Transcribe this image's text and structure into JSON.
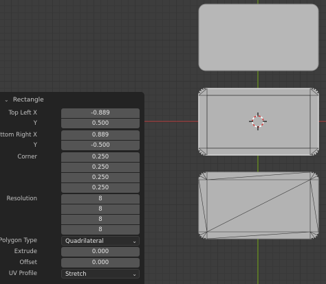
{
  "panel": {
    "title": "Rectangle",
    "top_left_x_label": "Top Left X",
    "top_left_x": "-0.889",
    "top_left_y_label": "Y",
    "top_left_y": "0.500",
    "bottom_right_x_label": "Bottom Right X",
    "bottom_right_x": "0.889",
    "bottom_right_y_label": "Y",
    "bottom_right_y": "-0.500",
    "corner_label": "Corner",
    "corner": [
      "0.250",
      "0.250",
      "0.250",
      "0.250"
    ],
    "resolution_label": "Resolution",
    "resolution": [
      "8",
      "8",
      "8",
      "8"
    ],
    "polygon_type_label": "Polygon Type",
    "polygon_type": "Quadrilateral",
    "extrude_label": "Extrude",
    "extrude": "0.000",
    "offset_label": "Offset",
    "offset": "0.000",
    "uv_profile_label": "UV Profile",
    "uv_profile": "Stretch"
  },
  "icons": {
    "collapse": "chevron-down-icon",
    "dropdown": "chevron-down-icon",
    "cursor": "3d-cursor-icon"
  },
  "colors": {
    "x_axis": "#b43c3c",
    "y_axis": "#6f9a1f",
    "mesh_face": "#b7b7b7",
    "panel_bg": "#232323",
    "field_bg": "#545454"
  }
}
